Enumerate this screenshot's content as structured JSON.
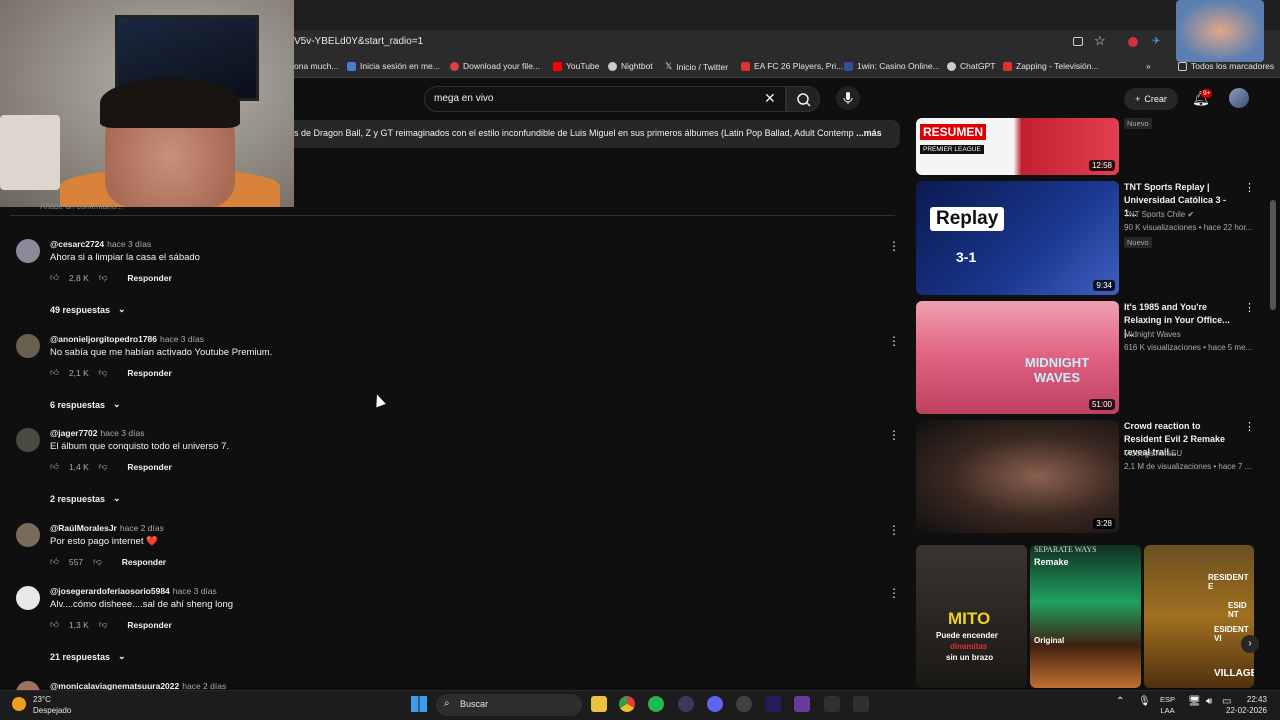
{
  "browser": {
    "url": "V5v-YBELd0Y&start_radio=1",
    "bookmarks": [
      {
        "label": "ona much...",
        "color": "#ff4444"
      },
      {
        "label": "Inicia sesión en me...",
        "color": "#4a7bd0"
      },
      {
        "label": "Download your file...",
        "color": "#e04040"
      },
      {
        "label": "YouTube",
        "color": "#ff0000"
      },
      {
        "label": "Nightbot",
        "color": "#cccccc"
      },
      {
        "label": "Inicio / Twitter",
        "color": "#111111"
      },
      {
        "label": "EA FC 26 Players, Pri...",
        "color": "#e03030"
      },
      {
        "label": "1win: Casino Online...",
        "color": "#3050a0"
      },
      {
        "label": "ChatGPT",
        "color": "#cccccc"
      },
      {
        "label": "Zapping - Televisión...",
        "color": "#e03030"
      }
    ],
    "all_bookmarks": "Todos los marcadores"
  },
  "youtube": {
    "search_value": "mega en vivo",
    "create_label": "Crear",
    "notification_count": "9+",
    "description_snippet": "s de Dragon Ball, Z y GT reimaginados con el estilo inconfundible de Luis Miguel en sus primeros álbumes (Latin Pop Ballad, Adult Contemp",
    "more_label": "...más",
    "partial_comment_text": "Añade un comentario..."
  },
  "comments": [
    {
      "user": "@cesarc2724",
      "time": "hace 3 días",
      "text": "Ahora si a limpiar la casa el sábado",
      "likes": "2,8 K",
      "reply": "Responder",
      "replies": "49 respuestas",
      "avatar": "#8a8a9a"
    },
    {
      "user": "@anonieljorgitopedro1786",
      "time": "hace 3 días",
      "text": "No sabía que me habían activado Youtube Premium.",
      "likes": "2,1 K",
      "reply": "Responder",
      "replies": "6 respuestas",
      "avatar": "#6a6050"
    },
    {
      "user": "@jager7702",
      "time": "hace 3 días",
      "text": "El álbum que conquisto todo el universo 7.",
      "likes": "1,4 K",
      "reply": "Responder",
      "replies": "2 respuestas",
      "avatar": "#4a4a40"
    },
    {
      "user": "@RaúlMoralesJr",
      "time": "hace 2 días",
      "text": "Por esto pago internet ❤️",
      "likes": "557",
      "reply": "Responder",
      "replies": "",
      "avatar": "#7a6a5a"
    },
    {
      "user": "@josegerardoferiaosorio5984",
      "time": "hace 3 días",
      "text": "Alv....cómo disheee....sal de ahí sheng long",
      "likes": "1,3 K",
      "reply": "Responder",
      "replies": "21 respuestas",
      "avatar": "#e8e8e8"
    },
    {
      "user": "@monicalaviagnematsuura2022",
      "time": "hace 2 días",
      "text": "",
      "likes": "",
      "reply": "",
      "replies": "",
      "avatar": "#a07060"
    }
  ],
  "sidebar": [
    {
      "title": "",
      "channel": "",
      "meta": "",
      "badge": "Nuevo",
      "duration": "12:58",
      "thumb_text": "RESUMEN",
      "thumb_sub": "PREMIER LEAGUE"
    },
    {
      "title": "TNT Sports Replay | Universidad Católica 3 - 1...",
      "channel": "TNT Sports Chile",
      "meta": "90 K visualizaciones • hace 22 hor...",
      "badge": "Nuevo",
      "duration": "9:34",
      "thumb_text": "Replay",
      "thumb_sub": "3-1"
    },
    {
      "title": "It's 1985 and You're Relaxing in Your Office... |...",
      "channel": "Midnight Waves",
      "meta": "616 K visualizaciones • hace 5 me...",
      "badge": "",
      "duration": "51:00",
      "thumb_text": "MIDNIGHT WAVES",
      "thumb_sub": ""
    },
    {
      "title": "Crowd reaction to Resident Evil 2 Remake reveal trail...",
      "channel": "VideogamersEU",
      "meta": "2,1 M de visualizaciones • hace 7 ...",
      "badge": "",
      "duration": "3:28",
      "thumb_text": "",
      "thumb_sub": ""
    }
  ],
  "shelf": {
    "mito": "MITO",
    "mito_sub1": "Puede encender",
    "mito_sub2": "dinamitas",
    "mito_sub3": "sin un brazo",
    "separate": "SEPARATE WAYS",
    "remake": "Remake",
    "original": "Original",
    "re1": "RESIDENT E",
    "re2": "ESID NT",
    "re3": "ESIDENT VI",
    "re4": "VILLAGE"
  },
  "taskbar": {
    "temp": "23°C",
    "weather": "Despejado",
    "search": "Buscar",
    "lang1": "ESP",
    "lang2": "LAA",
    "time": "22:43",
    "date": "22-02-2026"
  }
}
